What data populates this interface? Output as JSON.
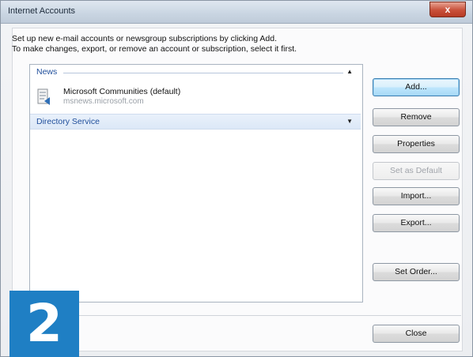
{
  "window": {
    "title": "Internet Accounts",
    "close_glyph": "x"
  },
  "intro": {
    "line1": "Set up new e-mail accounts or newsgroup subscriptions by clicking Add.",
    "line2": "To make changes, export, or remove an account or subscription, select it first."
  },
  "list": {
    "groups": [
      {
        "label": "News",
        "expanded": true,
        "items": [
          {
            "name": "Microsoft Communities (default)",
            "server": "msnews.microsoft.com",
            "icon": "news-account-icon"
          }
        ]
      },
      {
        "label": "Directory Service",
        "expanded": false
      }
    ]
  },
  "buttons": {
    "add": "Add...",
    "remove": "Remove",
    "properties": "Properties",
    "set_default": "Set as Default",
    "import": "Import...",
    "export": "Export...",
    "set_order": "Set Order...",
    "close": "Close"
  },
  "badge": {
    "number": "2"
  },
  "colors": {
    "accent": "#1f7fc4",
    "group_text": "#1f4e9b",
    "selection": "#dce8f7"
  }
}
